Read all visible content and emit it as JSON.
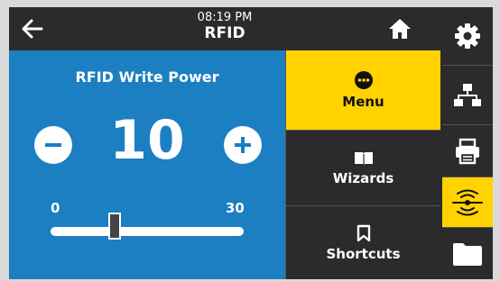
{
  "header": {
    "time": "08:19 PM",
    "title": "RFID"
  },
  "setting": {
    "label": "RFID Write Power",
    "value": "10",
    "min_label": "0",
    "max_label": "30",
    "min": 0,
    "max": 30,
    "level": 10
  },
  "menu": {
    "items": [
      {
        "label": "Menu",
        "icon": "dots-circle-icon",
        "active": true
      },
      {
        "label": "Wizards",
        "icon": "book-icon",
        "active": false
      },
      {
        "label": "Shortcuts",
        "icon": "bookmark-icon",
        "active": false
      }
    ]
  },
  "sidebar": {
    "items": [
      "gear-icon",
      "network-icon",
      "printer-icon",
      "rfid-icon",
      "folder-icon"
    ],
    "active": "rfid-icon"
  },
  "colors": {
    "accent": "#ffd200",
    "panel_blue": "#1b7fc2",
    "dark": "#2b2b2b"
  }
}
